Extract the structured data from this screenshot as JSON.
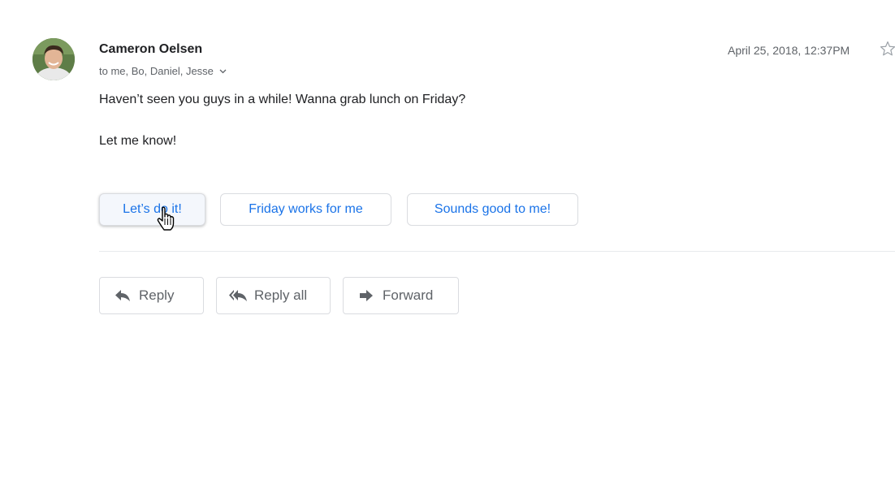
{
  "message": {
    "sender": "Cameron Oelsen",
    "recipients": "to me, Bo, Daniel, Jesse",
    "timestamp": "April 25, 2018, 12:37PM",
    "body": [
      "Haven’t seen you guys in a while! Wanna grab lunch on Friday?",
      "Let me know!"
    ]
  },
  "smart_replies": [
    {
      "label": "Let’s do it!"
    },
    {
      "label": "Friday works for me"
    },
    {
      "label": "Sounds good to me!"
    }
  ],
  "actions": {
    "reply": "Reply",
    "reply_all": "Reply all",
    "forward": "Forward"
  },
  "icons": {
    "avatar": "avatar-photo",
    "recipients_toggle": "chevron-down-icon",
    "star": "star-outline-icon",
    "reply": "reply-icon",
    "reply_all": "reply-all-icon",
    "forward": "forward-icon",
    "cursor": "hand-pointer-cursor"
  },
  "colors": {
    "accent": "#1a73e8",
    "text": "#202124",
    "secondary_text": "#5f6368",
    "border": "#dadce0"
  }
}
